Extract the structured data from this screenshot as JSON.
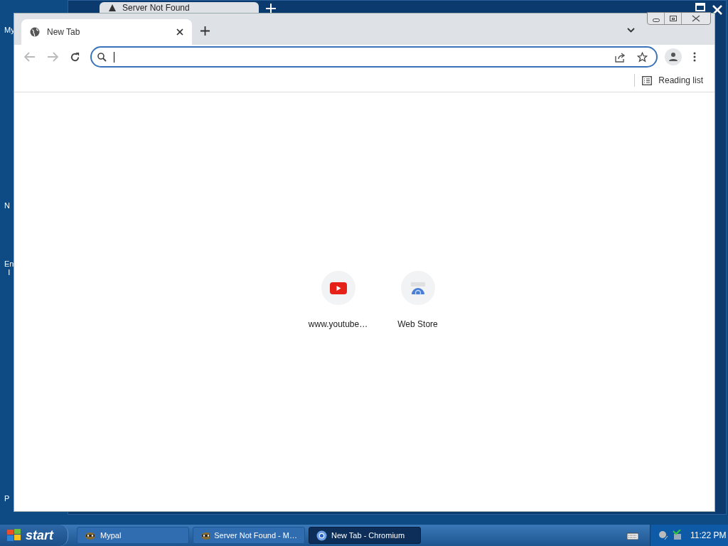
{
  "desktop_icons": [
    {
      "lines": [
        "My"
      ]
    },
    {
      "lines": [
        "N"
      ]
    },
    {
      "lines": [
        "En",
        "I"
      ]
    },
    {
      "lines": [
        "P"
      ]
    }
  ],
  "background_window": {
    "tab_title": "Server Not Found"
  },
  "browser": {
    "tabs": [
      {
        "title": "New Tab",
        "selected": true
      }
    ],
    "toolbar": {
      "back_disabled": true,
      "forward_disabled": true
    },
    "reading_list": "Reading list",
    "shortcuts": [
      {
        "title": "www.youtube…",
        "kind": "youtube"
      },
      {
        "title": "Web Store",
        "kind": "webstore"
      }
    ]
  },
  "taskbar": {
    "start": "start",
    "tasks": [
      {
        "title": "Mypal",
        "kind": "mypal",
        "selected": false
      },
      {
        "title": "Server Not Found - M…",
        "kind": "mypal",
        "selected": false
      },
      {
        "title": "New Tab - Chromium",
        "kind": "chromium",
        "selected": true
      }
    ],
    "clock": "11:22 PM"
  }
}
